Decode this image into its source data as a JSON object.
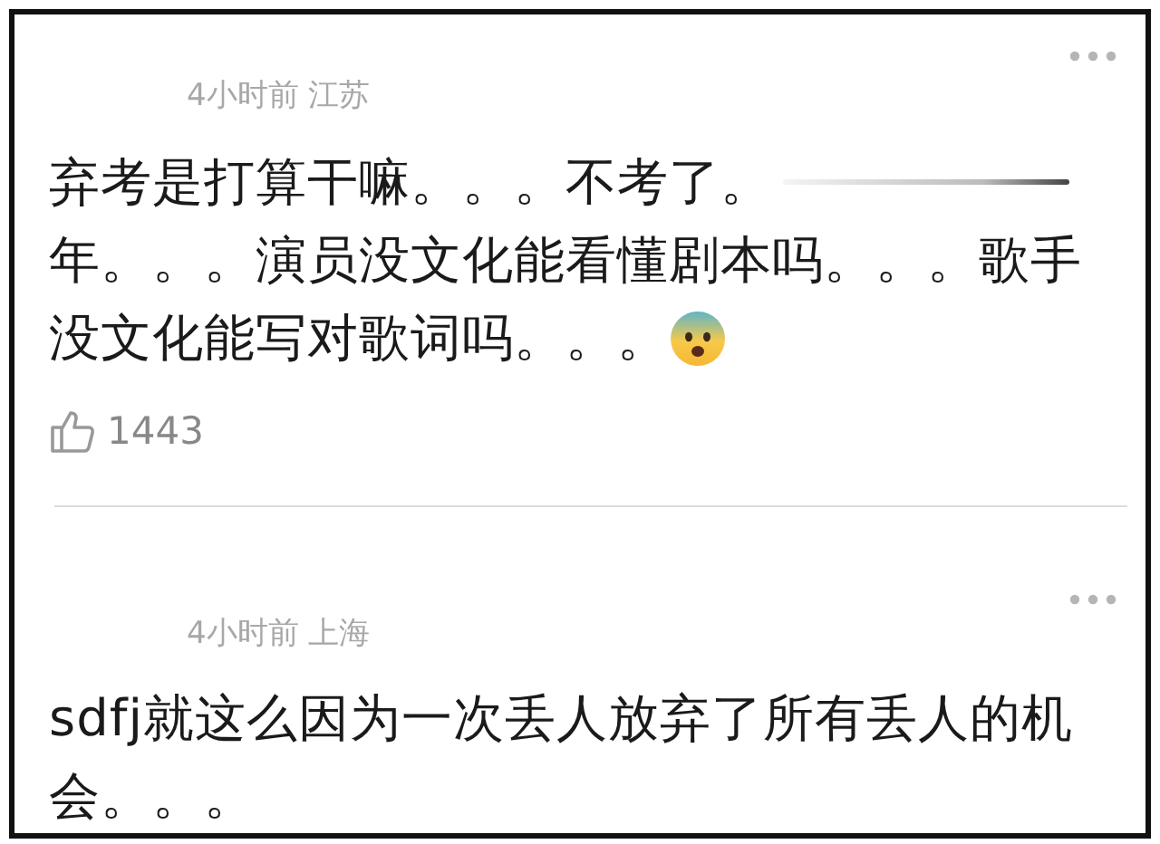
{
  "comments": [
    {
      "meta": "4小时前 江苏",
      "lines": [
        {
          "text": "弃考是打算干嘛。。。不考了。",
          "redacted": true,
          "emoji": false
        },
        {
          "text": "年。。。演员没文化能看懂剧本吗。。。歌手",
          "redacted": false,
          "emoji": false
        },
        {
          "text": "没文化能写对歌词吗。。。",
          "redacted": false,
          "emoji": true
        }
      ],
      "likes": "1443"
    },
    {
      "meta": "4小时前 上海",
      "lines": [
        {
          "text": "sdfj就这么因为一次丢人放弃了所有丢人的机",
          "redacted": false,
          "emoji": false
        },
        {
          "text": "会。。。",
          "redacted": false,
          "emoji": false
        }
      ]
    }
  ]
}
